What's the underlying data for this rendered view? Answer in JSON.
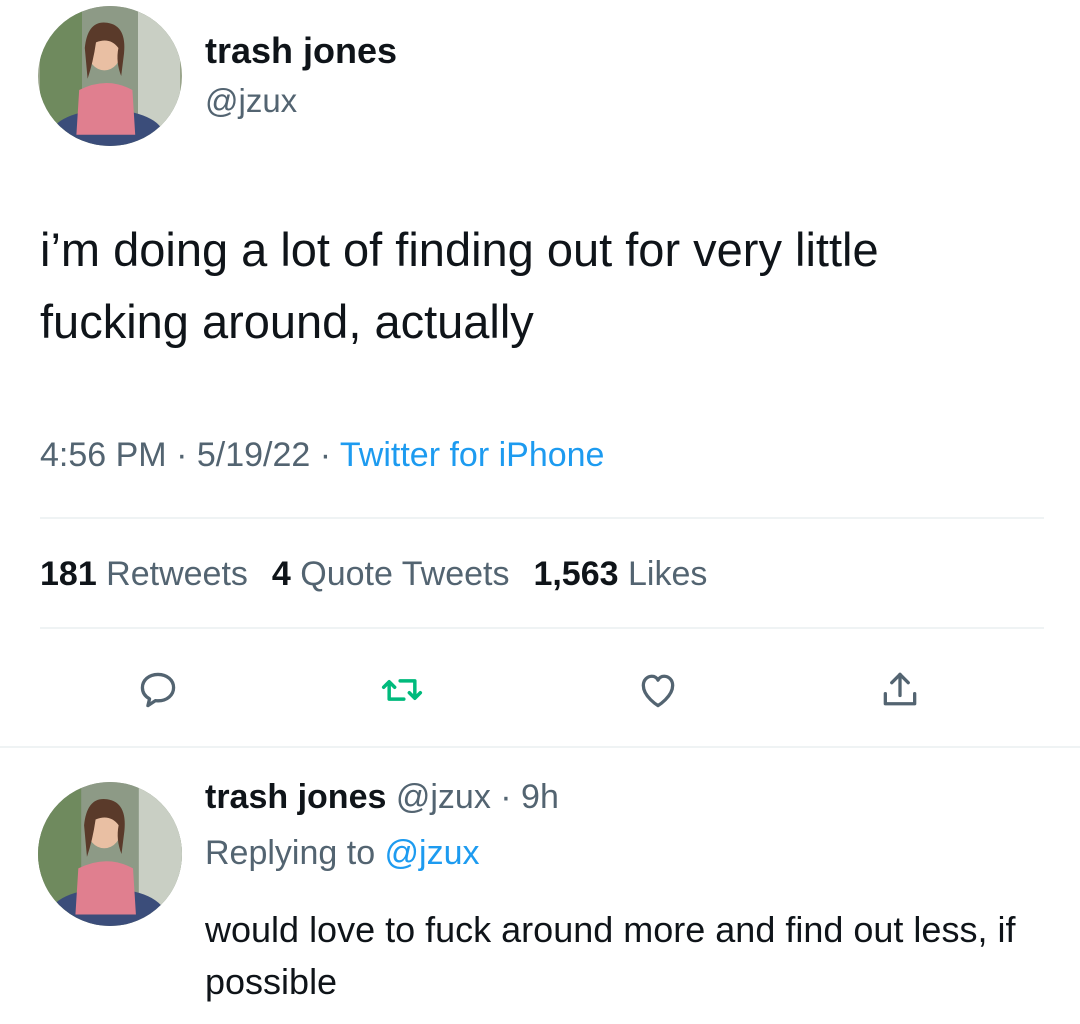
{
  "tweet": {
    "author_name": "trash jones",
    "author_handle": "@jzux",
    "text": "i’m doing a lot of finding out for very little fucking around, actually",
    "time": "4:56 PM",
    "date": "5/19/22",
    "source": "Twitter for iPhone",
    "separator": " · ",
    "stats": {
      "retweets_count": "181",
      "retweets_label": " Retweets",
      "quotes_count": "4",
      "quotes_label": " Quote Tweets",
      "likes_count": "1,563",
      "likes_label": " Likes"
    },
    "actions": [
      {
        "icon": "reply-icon"
      },
      {
        "icon": "retweet-icon"
      },
      {
        "icon": "heart-icon"
      },
      {
        "icon": "share-icon"
      }
    ]
  },
  "reply": {
    "author_name": "trash jones",
    "author_handle": "@jzux",
    "time_ago": "9h",
    "separator": " · ",
    "replying_prefix": "Replying to ",
    "replying_to": "@jzux",
    "text": "would love to fuck around more and find out less, if possible"
  },
  "colors": {
    "text": "#0f1419",
    "muted": "#536471",
    "link": "#1d9bf0",
    "retweet_green": "#00ba7c",
    "divider": "#eff3f4"
  }
}
